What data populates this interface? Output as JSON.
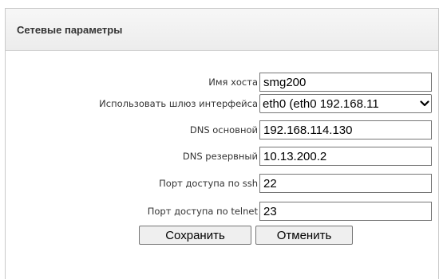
{
  "panel": {
    "title": "Сетевые параметры"
  },
  "form": {
    "hostname": {
      "label": "Имя хоста",
      "value": "smg200"
    },
    "gateway": {
      "label": "Использовать шлюз интерфейса",
      "value": "eth0 (eth0 192.168.11"
    },
    "dns_primary": {
      "label": "DNS основной",
      "value": "192.168.114.130"
    },
    "dns_secondary": {
      "label": "DNS резервный",
      "value": "10.13.200.2"
    },
    "ssh_port": {
      "label": "Порт доступа по ssh",
      "value": "22"
    },
    "telnet_port": {
      "label": "Порт доступа по telnet",
      "value": "23"
    }
  },
  "actions": {
    "save_label": "Сохранить",
    "cancel_label": "Отменить"
  },
  "icons": {
    "dropdown": "chevron-down-icon"
  }
}
